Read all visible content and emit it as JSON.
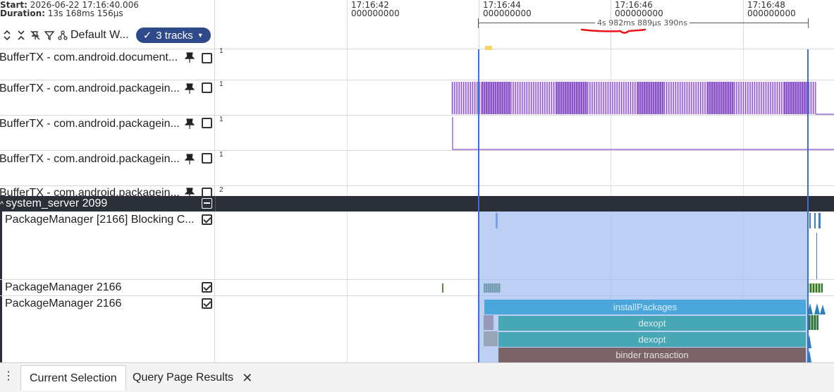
{
  "header": {
    "start_label": "Start:",
    "start_value": "2026-06-22 17:16:40.006",
    "duration_label": "Duration:",
    "duration_value": "13s 168ms 156μs",
    "workspace_label": "Default W...",
    "tracks_pill": "3 tracks",
    "measure_label": "4s 982ms 889μs 390ns"
  },
  "timeline": {
    "ticks": [
      {
        "time": "17:16:42",
        "sub": "000000000"
      },
      {
        "time": "17:16:44",
        "sub": "000000000"
      },
      {
        "time": "17:16:46",
        "sub": "000000000"
      },
      {
        "time": "17:16:48",
        "sub": "000000000"
      }
    ]
  },
  "pinned_tracks": [
    {
      "name": "BufferTX - com.android.document...",
      "value": "1"
    },
    {
      "name": "BufferTX - com.android.packagein...",
      "value": "1"
    },
    {
      "name": "BufferTX - com.android.packagein...",
      "value": "1"
    },
    {
      "name": "BufferTX - com.android.packagein...",
      "value": "1"
    },
    {
      "name": "BufferTX - com.android.packagein...",
      "value": "2"
    }
  ],
  "group": {
    "name": "system_server 2099"
  },
  "tracks": [
    {
      "name": "PackageManager [2166] Blocking C..."
    },
    {
      "name": "PackageManager 2166"
    },
    {
      "name": "PackageManager 2166"
    }
  ],
  "slices": {
    "install": "installPackages",
    "dexopt1": "dexopt",
    "dexopt2": "dexopt",
    "binder": "binder transaction"
  },
  "tabs": [
    {
      "label": "Current Selection"
    },
    {
      "label": "Query Page Results"
    }
  ],
  "colors": {
    "accent": "#2f4a8a",
    "selection": "#3b6fd6",
    "selection_fill": "#bcd0f2",
    "counter": "#8a52c8",
    "install": "#4aa6db",
    "dexopt": "#48a7b5",
    "binder": "#7a6467"
  }
}
